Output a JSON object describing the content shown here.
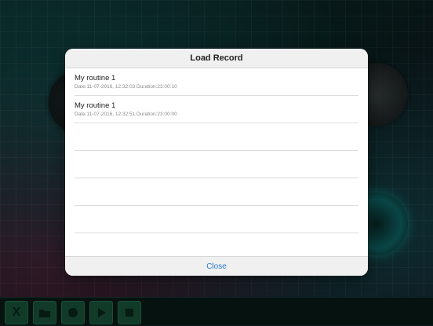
{
  "modal": {
    "title": "Load Record",
    "records": [
      {
        "name": "My routine 1",
        "meta": "Date:11-07-2016, 12:32:03 Duration:23:00:10"
      },
      {
        "name": "My routine 1",
        "meta": "Date:11-07-2016, 12:32:51 Duration:23:00:00"
      }
    ],
    "close_label": "Close"
  },
  "toolbar": {
    "buttons": [
      {
        "icon": "x-icon",
        "label": "X"
      },
      {
        "icon": "folder-icon"
      },
      {
        "icon": "record-icon"
      },
      {
        "icon": "play-icon"
      },
      {
        "icon": "stop-icon"
      }
    ]
  },
  "colors": {
    "accent": "#2a7ad4",
    "toolbar_button": "#1b5a3e"
  }
}
